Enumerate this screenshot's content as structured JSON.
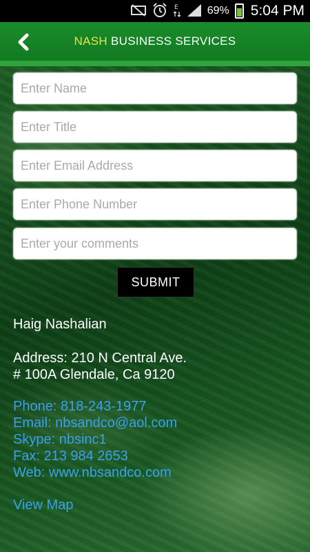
{
  "status_bar": {
    "battery_percent": "69%",
    "time": "5:04 PM",
    "icons": [
      "mute-icon",
      "alarm-icon",
      "data-icon",
      "signal-icon",
      "battery-icon"
    ]
  },
  "header": {
    "title_accent": "NASH",
    "title_rest": " BUSINESS SERVICES",
    "back_icon": "chevron-left-icon"
  },
  "form": {
    "name_placeholder": "Enter Name",
    "title_placeholder": "Enter Title",
    "email_placeholder": "Enter Email Address",
    "phone_placeholder": "Enter Phone Number",
    "comments_placeholder": "Enter your comments",
    "submit_label": "SUBMIT"
  },
  "contact": {
    "name": "Haig Nashalian",
    "address_line1": "Address: 210 N Central Ave.",
    "address_line2": "# 100A Glendale, Ca 9120",
    "phone": "Phone: 818-243-1977",
    "email": "Email: nbsandco@aol.com",
    "skype": "Skype: nbsinc1",
    "fax": "Fax: 213 984 2653",
    "web": "Web: www.nbsandco.com",
    "map": "View Map"
  },
  "colors": {
    "header_green": "#1a8c2a",
    "title_accent": "#f1e04a",
    "link_blue": "#3aa0f0"
  }
}
